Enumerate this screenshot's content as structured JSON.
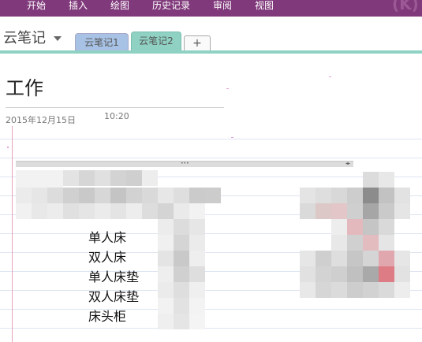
{
  "ribbon": {
    "tabs": [
      {
        "label": "开始"
      },
      {
        "label": "插入"
      },
      {
        "label": "绘图"
      },
      {
        "label": "历史记录"
      },
      {
        "label": "审阅"
      },
      {
        "label": "视图"
      }
    ]
  },
  "notebook": {
    "title": "云笔记",
    "sections": [
      {
        "label": "云笔记1"
      },
      {
        "label": "云笔记2"
      }
    ],
    "add_label": "+"
  },
  "page": {
    "title": "工作",
    "date": "2015年12月15日",
    "time": "10:20"
  },
  "list": {
    "items": [
      "单人床",
      "双人床",
      "单人床垫",
      "双人床垫",
      "床头柜"
    ]
  },
  "colors": {
    "ribbon": "#80397b",
    "section_active": "#8fd2c4",
    "section_inactive": "#a7c2e4"
  }
}
